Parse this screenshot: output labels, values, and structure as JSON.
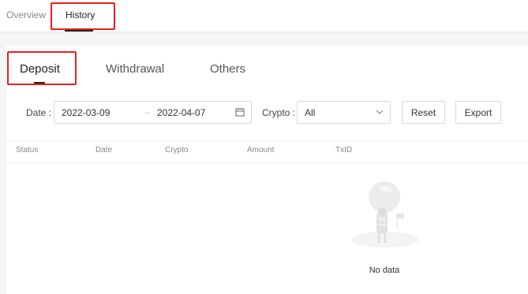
{
  "top_tabs": [
    {
      "label": "Overview",
      "active": false
    },
    {
      "label": "History",
      "active": true
    }
  ],
  "sub_tabs": [
    {
      "label": "Deposit",
      "active": true
    },
    {
      "label": "Withdrawal",
      "active": false
    },
    {
      "label": "Others",
      "active": false
    }
  ],
  "filters": {
    "date_label": "Date",
    "date_colon": ":",
    "start_date": "2022-03-09",
    "end_date": "2022-04-07",
    "crypto_label": "Crypto",
    "crypto_colon": ":",
    "crypto_value": "All",
    "reset_label": "Reset",
    "export_label": "Export"
  },
  "table": {
    "columns": [
      "Status",
      "Date",
      "Crypto",
      "Amount",
      "TxID"
    ],
    "rows": []
  },
  "empty_state": {
    "text": "No data"
  },
  "colors": {
    "highlight": "#e8201f",
    "text": "#333333",
    "muted": "#888888"
  }
}
